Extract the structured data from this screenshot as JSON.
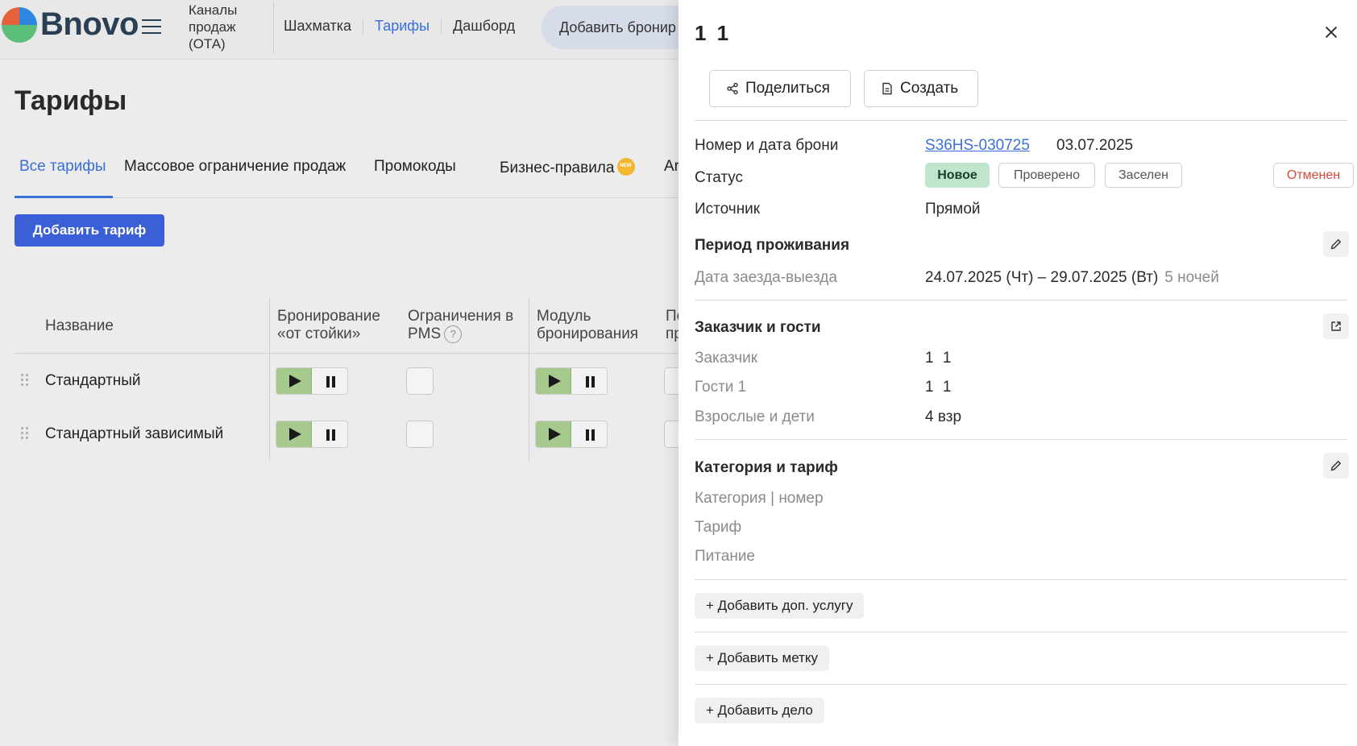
{
  "app": {
    "brand": "Bnovo",
    "nav": {
      "ota": "Каналы продаж (ОТА)",
      "links": [
        "Шахматка",
        "Тарифы",
        "Дашборд"
      ],
      "active_link": "Тарифы",
      "add_booking": "Добавить бронир"
    },
    "page_title": "Тарифы",
    "tabs": [
      "Все тарифы",
      "Массовое ограничение продаж",
      "Промокоды",
      "Бизнес-правила",
      "Ar"
    ],
    "new_badge": "NEW",
    "add_tariff": "Добавить тариф",
    "table": {
      "headers": [
        "Название",
        "Бронирование «от стойки»",
        "Ограничения в PMS",
        "Модуль бронирования",
        "По при"
      ],
      "help_mark": "?",
      "rows": [
        {
          "name": "Стандартный"
        },
        {
          "name": "Стандартный зависимый"
        }
      ]
    }
  },
  "drawer": {
    "title": "1 1",
    "share_button": "Поделиться",
    "create_button": "Создать",
    "booking_label": "Номер и дата брони",
    "booking_number": "S36HS-030725",
    "booking_date": "03.07.2025",
    "status_label": "Статус",
    "statuses": [
      "Новое",
      "Проверено",
      "Заселен",
      "Отменен"
    ],
    "active_status": "Новое",
    "source_label": "Источник",
    "source_value": "Прямой",
    "stay_section": "Период проживания",
    "dates_label": "Дата заезда-выезда",
    "dates_value": "24.07.2025 (Чт) – 29.07.2025 (Вт)",
    "nights": "5 ночей",
    "guests_section": "Заказчик и гости",
    "customer_label": "Заказчик",
    "customer_value": "1 1",
    "guests_label": "Гости 1",
    "guests_value": "1 1",
    "adults_label": "Взрослые и дети",
    "adults_value": "4 взр",
    "category_section": "Категория и тариф",
    "category_label": "Категория | номер",
    "tariff_label": "Тариф",
    "meal_label": "Питание",
    "add_service": "+ Добавить доп. услугу",
    "add_tag": "+ Добавить метку",
    "add_task": "+ Добавить дело"
  }
}
